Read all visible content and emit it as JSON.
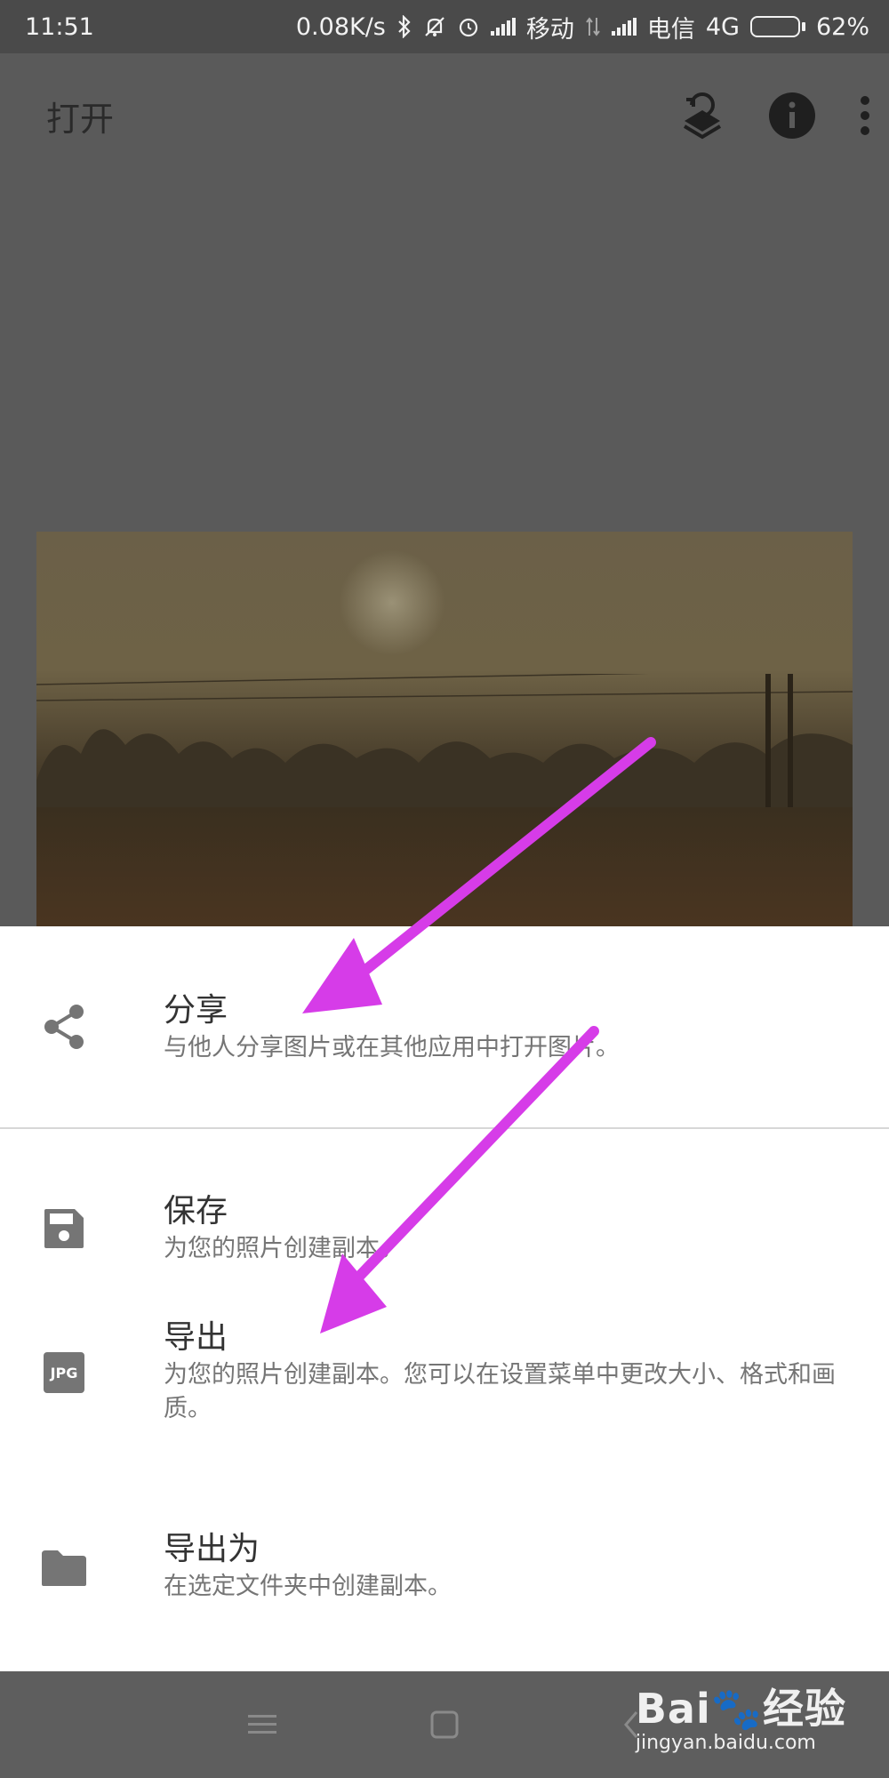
{
  "status_bar": {
    "time": "11:51",
    "speed": "0.08K/s",
    "carrier1": "移动",
    "carrier2": "电信",
    "network": "4G",
    "battery_text": "62%",
    "battery_level": 0.62,
    "icons": [
      "bluetooth-icon",
      "mute-icon",
      "alarm-icon",
      "signal-icon",
      "data-icon",
      "signal-icon",
      "battery-icon"
    ]
  },
  "app_bar": {
    "title": "打开",
    "actions": [
      "layers-revert-icon",
      "info-icon",
      "more-vert-icon"
    ]
  },
  "sheet": {
    "items": [
      {
        "icon": "share-icon",
        "title": "分享",
        "subtitle": "与他人分享图片或在其他应用中打开图片。"
      },
      {
        "icon": "save-icon",
        "title": "保存",
        "subtitle": "为您的照片创建副本。"
      },
      {
        "icon": "jpg-icon",
        "icon_text": "JPG",
        "title": "导出",
        "subtitle": "为您的照片创建副本。您可以在设置菜单中更改大小、格式和画质。"
      },
      {
        "icon": "folder-icon",
        "title": "导出为",
        "subtitle": "在选定文件夹中创建副本。"
      }
    ]
  },
  "nav_bar": {
    "buttons": [
      "menu-icon",
      "home-icon",
      "back-icon"
    ]
  },
  "watermark": {
    "brand": "Bai",
    "brand2": "经验",
    "url": "jingyan.baidu.com"
  },
  "colors": {
    "arrow": "#d63ce8",
    "dim": "#5a5a5a",
    "sheet": "#ffffff"
  }
}
